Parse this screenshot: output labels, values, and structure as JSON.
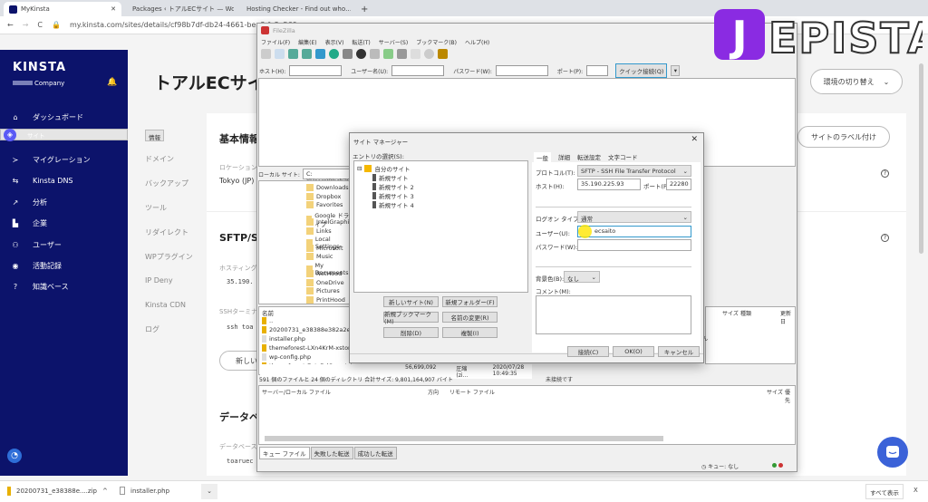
{
  "browser": {
    "tabs": [
      {
        "label": "MyKinsta",
        "active": true
      },
      {
        "label": "Packages ‹ トアルECサイト — Wor…"
      },
      {
        "label": "Hosting Checker - Find out who…"
      }
    ],
    "new_tab": "+",
    "url": "my.kinsta.com/sites/details/cf98b7df-db24-4661-bea8-fc8a560"
  },
  "sidebar": {
    "brand": "KINSTA",
    "company": "Company",
    "items": [
      {
        "label": "ダッシュボード",
        "icon": "home-icon"
      },
      {
        "label": "サイト",
        "icon": "layers-icon",
        "selected": true
      },
      {
        "label": "マイグレーション",
        "icon": "migration-icon"
      },
      {
        "label": "Kinsta DNS",
        "icon": "dns-icon"
      },
      {
        "label": "分析",
        "icon": "chart-icon"
      },
      {
        "label": "企業",
        "icon": "building-icon"
      },
      {
        "label": "ユーザー",
        "icon": "user-add-icon"
      },
      {
        "label": "活動記録",
        "icon": "eye-icon"
      },
      {
        "label": "知識ベース",
        "icon": "help-icon"
      }
    ]
  },
  "page": {
    "title": "トアルECサイト",
    "env_switch": "環境の切り替え",
    "label_button": "サイトのラベル付け",
    "subnav": [
      "情報",
      "ドメイン",
      "バックアップ",
      "ツール",
      "リダイレクト",
      "WPプラグイン",
      "IP Deny",
      "Kinsta CDN",
      "ログ"
    ],
    "basic_info": "基本情報",
    "location_label": "ロケーション",
    "location": "Tokyo (JP)",
    "sftp": "SFTP/SSH",
    "hosting_label": "ホスティング",
    "host_ip": "35.190.",
    "ssh_label": "SSHターミナル",
    "ssh_cmd": "ssh toa",
    "new_btn": "新しい",
    "database": "データベ",
    "db_label": "データベース",
    "db_name": "toaruec"
  },
  "filezilla": {
    "title": "FileZilla",
    "menu": [
      "ファイル(F)",
      "編集(E)",
      "表示(V)",
      "転送(T)",
      "サーバー(S)",
      "ブックマーク(B)",
      "ヘルプ(H)"
    ],
    "quick": {
      "host": "ホスト(H):",
      "user": "ユーザー名(U):",
      "pass": "パスワード(W):",
      "port": "ポート(P):",
      "connect": "クイック接続(Q)"
    },
    "local_site_label": "ローカル サイト:",
    "local_path": "C:¥Users¥Yoshi¥Dow",
    "local_tree": [
      "Downloads",
      "Dropbox",
      "Favorites",
      "Google ドライブ",
      "IntelGraphics",
      "Links",
      "Local Settings",
      "Microsoft",
      "Music",
      "My Documents",
      "NetHood",
      "OneDrive",
      "Pictures",
      "PrintHood"
    ],
    "name_header": "名前",
    "files": [
      {
        "name": ".."
      },
      {
        "name": "20200731_e38388e382a2e383abe"
      },
      {
        "name": "installer.php"
      },
      {
        "name": "themeforest-LXn4KrM-xstore-re"
      },
      {
        "name": "wp-config.php"
      },
      {
        "name": "themeforest-7oIqDdCq-xstore-responsive-wooco...",
        "size": "56,699,092",
        "type": "圧縮 (zi...",
        "date": "2020/07/28 10:49:35"
      }
    ],
    "local_status": "591 個のファイルと 24 個のディレクトリ 合計サイズ: 9,801,164,907 バイト",
    "remote_headers": [
      "サイズ",
      "種類",
      "更新日"
    ],
    "remote_note": "ん",
    "remote_status": "未接続です",
    "queue_headers": [
      "サーバー/ローカル ファイル",
      "方向",
      "リモート ファイル",
      "サイズ",
      "優先"
    ],
    "queue_tabs": [
      "キュー ファイル",
      "失敗した転送",
      "成功した転送"
    ],
    "queue_status": "キュー: なし"
  },
  "site_manager": {
    "title": "サイト マネージャー",
    "entry_label": "エントリの選択(S):",
    "root": "自分のサイト",
    "sites": [
      "新規サイト",
      "新規サイト 2",
      "新規サイト 3",
      "新規サイト 4"
    ],
    "tabs": [
      "一般",
      "詳細",
      "転送設定",
      "文字コード"
    ],
    "protocol_label": "プロトコル(T):",
    "protocol": "SFTP - SSH File Transfer Protocol",
    "host_label": "ホスト(H):",
    "host": "35.190.225.93",
    "port_label": "ポート(P):",
    "port": "22280",
    "logon_label": "ログオン タイプ(L):",
    "logon": "通常",
    "user_label": "ユーザー(U):",
    "user": "ecsaito",
    "pass_label": "パスワード(W):",
    "bg_label": "背景色(B):",
    "bg": "なし",
    "comment_label": "コメント(M):",
    "buttons": [
      "新しいサイト(N)",
      "新規フォルダー(F)",
      "新規ブックマーク(M)",
      "名前の変更(R)",
      "削除(D)",
      "複製(I)"
    ],
    "connect": "接続(C)",
    "ok": "OK(O)",
    "cancel": "キャンセル"
  },
  "downloads": {
    "items": [
      "20200731_e38388e....zip",
      "installer.php"
    ],
    "show_all": "すべて表示",
    "close": "X"
  },
  "watermark": "JEPISTA",
  "colors": {
    "sidebar": "#0c136b",
    "accent": "#5b5bf5",
    "logo": "#8a2be2"
  }
}
